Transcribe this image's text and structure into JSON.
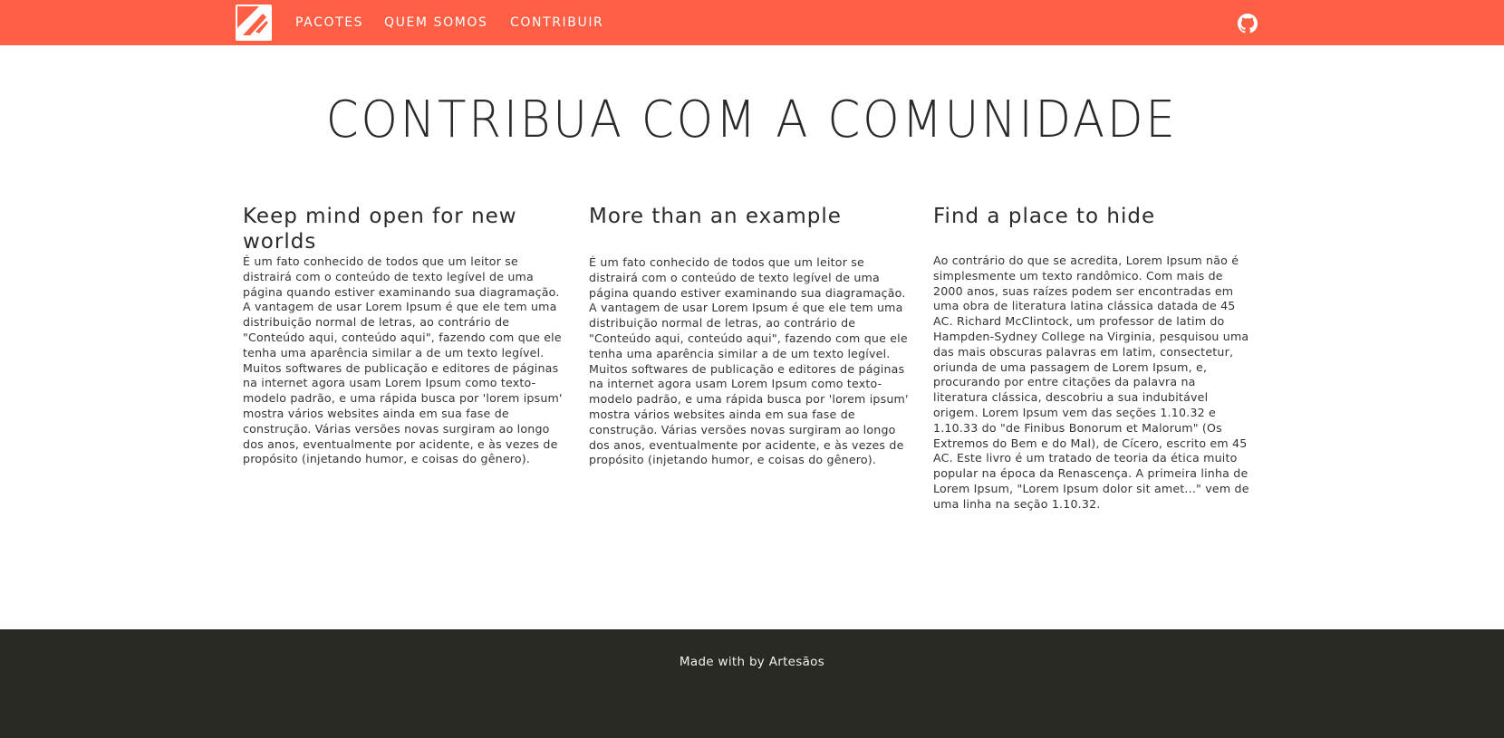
{
  "navbar": {
    "background_color": "#ff5f45",
    "logo_icon": "package-logo-icon",
    "items": [
      {
        "label": "PACOTES"
      },
      {
        "label": "QUEM SOMOS"
      },
      {
        "label": "CONTRIBUIR"
      }
    ],
    "github_icon": "github-icon"
  },
  "main": {
    "title": "CONTRIBUA COM A COMUNIDADE",
    "columns": [
      {
        "heading": "Keep mind open for new worlds",
        "body": "É um fato conhecido de todos que um leitor se distrairá com o conteúdo de texto legível de uma página quando estiver examinando sua diagramação. A vantagem de usar Lorem Ipsum é que ele tem uma distribuição normal de letras, ao contrário de \"Conteúdo aqui, conteúdo aqui\", fazendo com que ele tenha uma aparência similar a de um texto legível. Muitos softwares de publicação e editores de páginas na internet agora usam Lorem Ipsum como texto-modelo padrão, e uma rápida busca por 'lorem ipsum' mostra vários websites ainda em sua fase de construção. Várias versões novas surgiram ao longo dos anos, eventualmente por acidente, e às vezes de propósito (injetando humor, e coisas do gênero)."
      },
      {
        "heading": "More than an example",
        "body": "É um fato conhecido de todos que um leitor se distrairá com o conteúdo de texto legível de uma página quando estiver examinando sua diagramação. A vantagem de usar Lorem Ipsum é que ele tem uma distribuição normal de letras, ao contrário de \"Conteúdo aqui, conteúdo aqui\", fazendo com que ele tenha uma aparência similar a de um texto legível. Muitos softwares de publicação e editores de páginas na internet agora usam Lorem Ipsum como texto-modelo padrão, e uma rápida busca por 'lorem ipsum' mostra vários websites ainda em sua fase de construção. Várias versões novas surgiram ao longo dos anos, eventualmente por acidente, e às vezes de propósito (injetando humor, e coisas do gênero)."
      },
      {
        "heading": "Find a place to hide",
        "body": "Ao contrário do que se acredita, Lorem Ipsum não é simplesmente um texto randômico. Com mais de 2000 anos, suas raízes podem ser encontradas em uma obra de literatura latina clássica datada de 45 AC. Richard McClintock, um professor de latim do Hampden-Sydney College na Virginia, pesquisou uma das mais obscuras palavras em latim, consectetur, oriunda de uma passagem de Lorem Ipsum, e, procurando por entre citações da palavra na literatura clássica, descobriu a sua indubitável origem. Lorem Ipsum vem das seções 1.10.32 e 1.10.33 do \"de Finibus Bonorum et Malorum\" (Os Extremos do Bem e do Mal), de Cícero, escrito em 45 AC. Este livro é um tratado de teoria da ética muito popular na época da Renascença. A primeira linha de Lorem Ipsum, \"Lorem Ipsum dolor sit amet...\" vem de uma linha na seção 1.10.32."
      }
    ]
  },
  "footer": {
    "background_color": "#2a2a25",
    "text": "Made with by Artesãos"
  }
}
